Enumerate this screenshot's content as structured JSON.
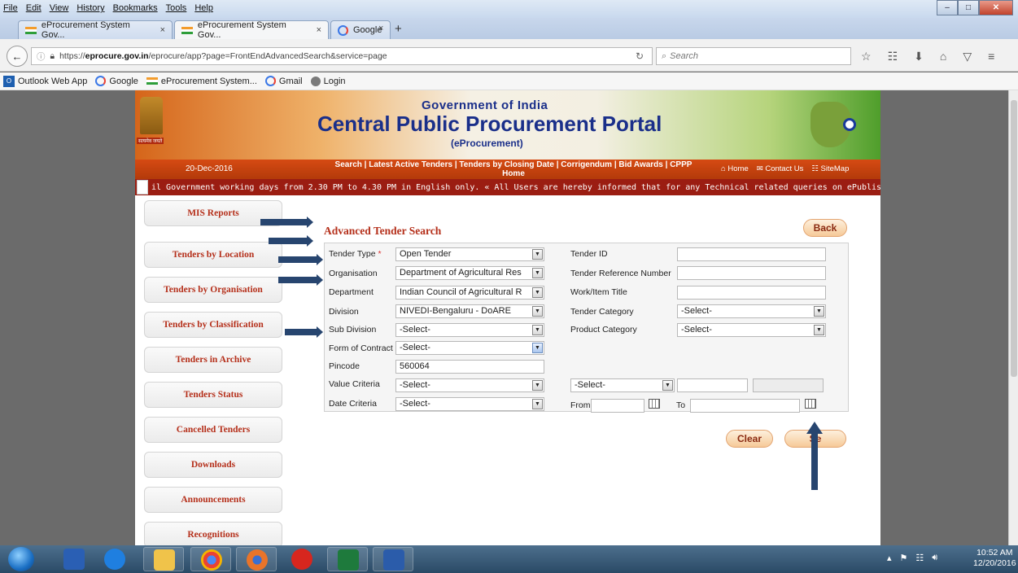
{
  "browser": {
    "menu": [
      "File",
      "Edit",
      "View",
      "History",
      "Bookmarks",
      "Tools",
      "Help"
    ],
    "tabs": [
      {
        "title": "eProcurement System Gov...",
        "close": "×"
      },
      {
        "title": "eProcurement System Gov...",
        "close": "×"
      },
      {
        "title": "Google",
        "close": "×"
      }
    ],
    "new_tab": "+",
    "url_prefix": "https://",
    "url_domain": "eprocure.gov.in",
    "url_path": "/eprocure/app?page=FrontEndAdvancedSearch&service=page",
    "search_placeholder": "Search",
    "bookmarks": [
      "Outlook Web App",
      "Google",
      "eProcurement System...",
      "Gmail",
      "Login"
    ]
  },
  "banner": {
    "emblem_caption": "सत्यमेव जयते",
    "gov": "Government of India",
    "title": "Central Public Procurement Portal",
    "subtitle": "(eProcurement)"
  },
  "nav": {
    "date": "20-Dec-2016",
    "links_line1": "Search | Latest Active Tenders | Tenders by Closing Date | Corrigendum | Bid Awards | CPPP",
    "links_line2": "Home",
    "home": "Home",
    "contact": "Contact Us",
    "sitemap": "SiteMap"
  },
  "ticker": "il Government working days from 2.30 PM to 4.30 PM in English only.    « All Users are hereby informed that for any Technical related queries on ePublishing and eProcure r",
  "sidebar": [
    "MIS Reports",
    "Tenders by Location",
    "Tenders by Organisation",
    "Tenders by Classification",
    "Tenders in Archive",
    "Tenders Status",
    "Cancelled Tenders",
    "Downloads",
    "Announcements",
    "Recognitions"
  ],
  "form": {
    "title": "Advanced Tender Search",
    "back": "Back",
    "tender_type_label": "Tender Type",
    "required_mark": "*",
    "tender_type_value": "Open Tender",
    "organisation_label": "Organisation",
    "organisation_value": "Department of Agricultural Res",
    "department_label": "Department",
    "department_value": "Indian Council of Agricultural R",
    "division_label": "Division",
    "division_value": "NIVEDI-Bengaluru - DoARE",
    "sub_division_label": "Sub Division",
    "sub_division_value": "-Select-",
    "form_of_contract_label": "Form of Contract",
    "form_of_contract_value": "-Select-",
    "pincode_label": "Pincode",
    "pincode_value": "560064",
    "value_criteria_label": "Value Criteria",
    "value_criteria_value": "-Select-",
    "value_criteria_op": "-Select-",
    "date_criteria_label": "Date Criteria",
    "date_criteria_value": "-Select-",
    "from_label": "From",
    "to_label": "To",
    "tender_id_label": "Tender ID",
    "tender_ref_label": "Tender Reference Number",
    "work_title_label": "Work/Item Title",
    "tender_category_label": "Tender Category",
    "tender_category_value": "-Select-",
    "product_category_label": "Product Category",
    "product_category_value": "-Select-",
    "clear": "Clear",
    "search": "Se"
  },
  "taskbar": {
    "time": "10:52 AM",
    "date": "12/20/2016"
  }
}
